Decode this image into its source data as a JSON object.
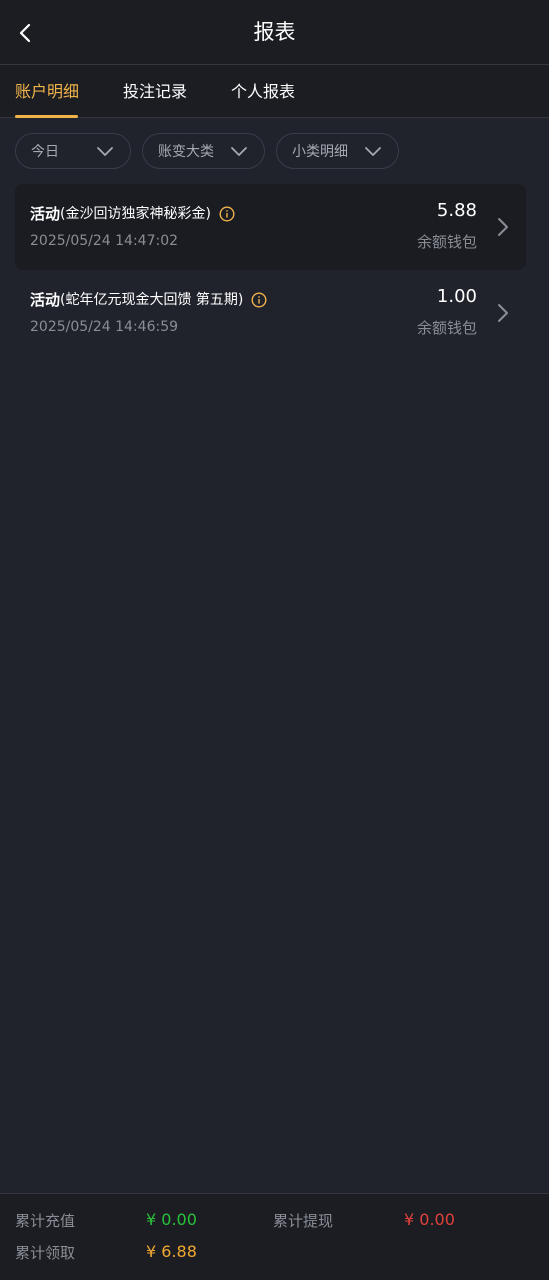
{
  "header": {
    "title": "报表"
  },
  "tabs": [
    {
      "label": "账户明细",
      "active": true
    },
    {
      "label": "投注记录",
      "active": false
    },
    {
      "label": "个人报表",
      "active": false
    }
  ],
  "filters": [
    {
      "label": "今日"
    },
    {
      "label": "账变大类"
    },
    {
      "label": "小类明细"
    }
  ],
  "records": [
    {
      "type": "活动",
      "detail": "(金沙回访独家神秘彩金)",
      "time": "2025/05/24 14:47:02",
      "amount": "5.88",
      "wallet": "余额钱包"
    },
    {
      "type": "活动",
      "detail": "(蛇年亿元现金大回馈 第五期)",
      "time": "2025/05/24 14:46:59",
      "amount": "1.00",
      "wallet": "余额钱包"
    }
  ],
  "summary": {
    "recharge_label": "累计充值",
    "recharge_value": "¥ 0.00",
    "withdraw_label": "累计提现",
    "withdraw_value": "¥ 0.00",
    "claim_label": "累计领取",
    "claim_value": "¥ 6.88"
  },
  "colors": {
    "accent": "#f0b34a",
    "background": "#20232b",
    "recharge": "#2ac13a",
    "withdraw": "#e0413c",
    "claim": "#f0a832"
  }
}
